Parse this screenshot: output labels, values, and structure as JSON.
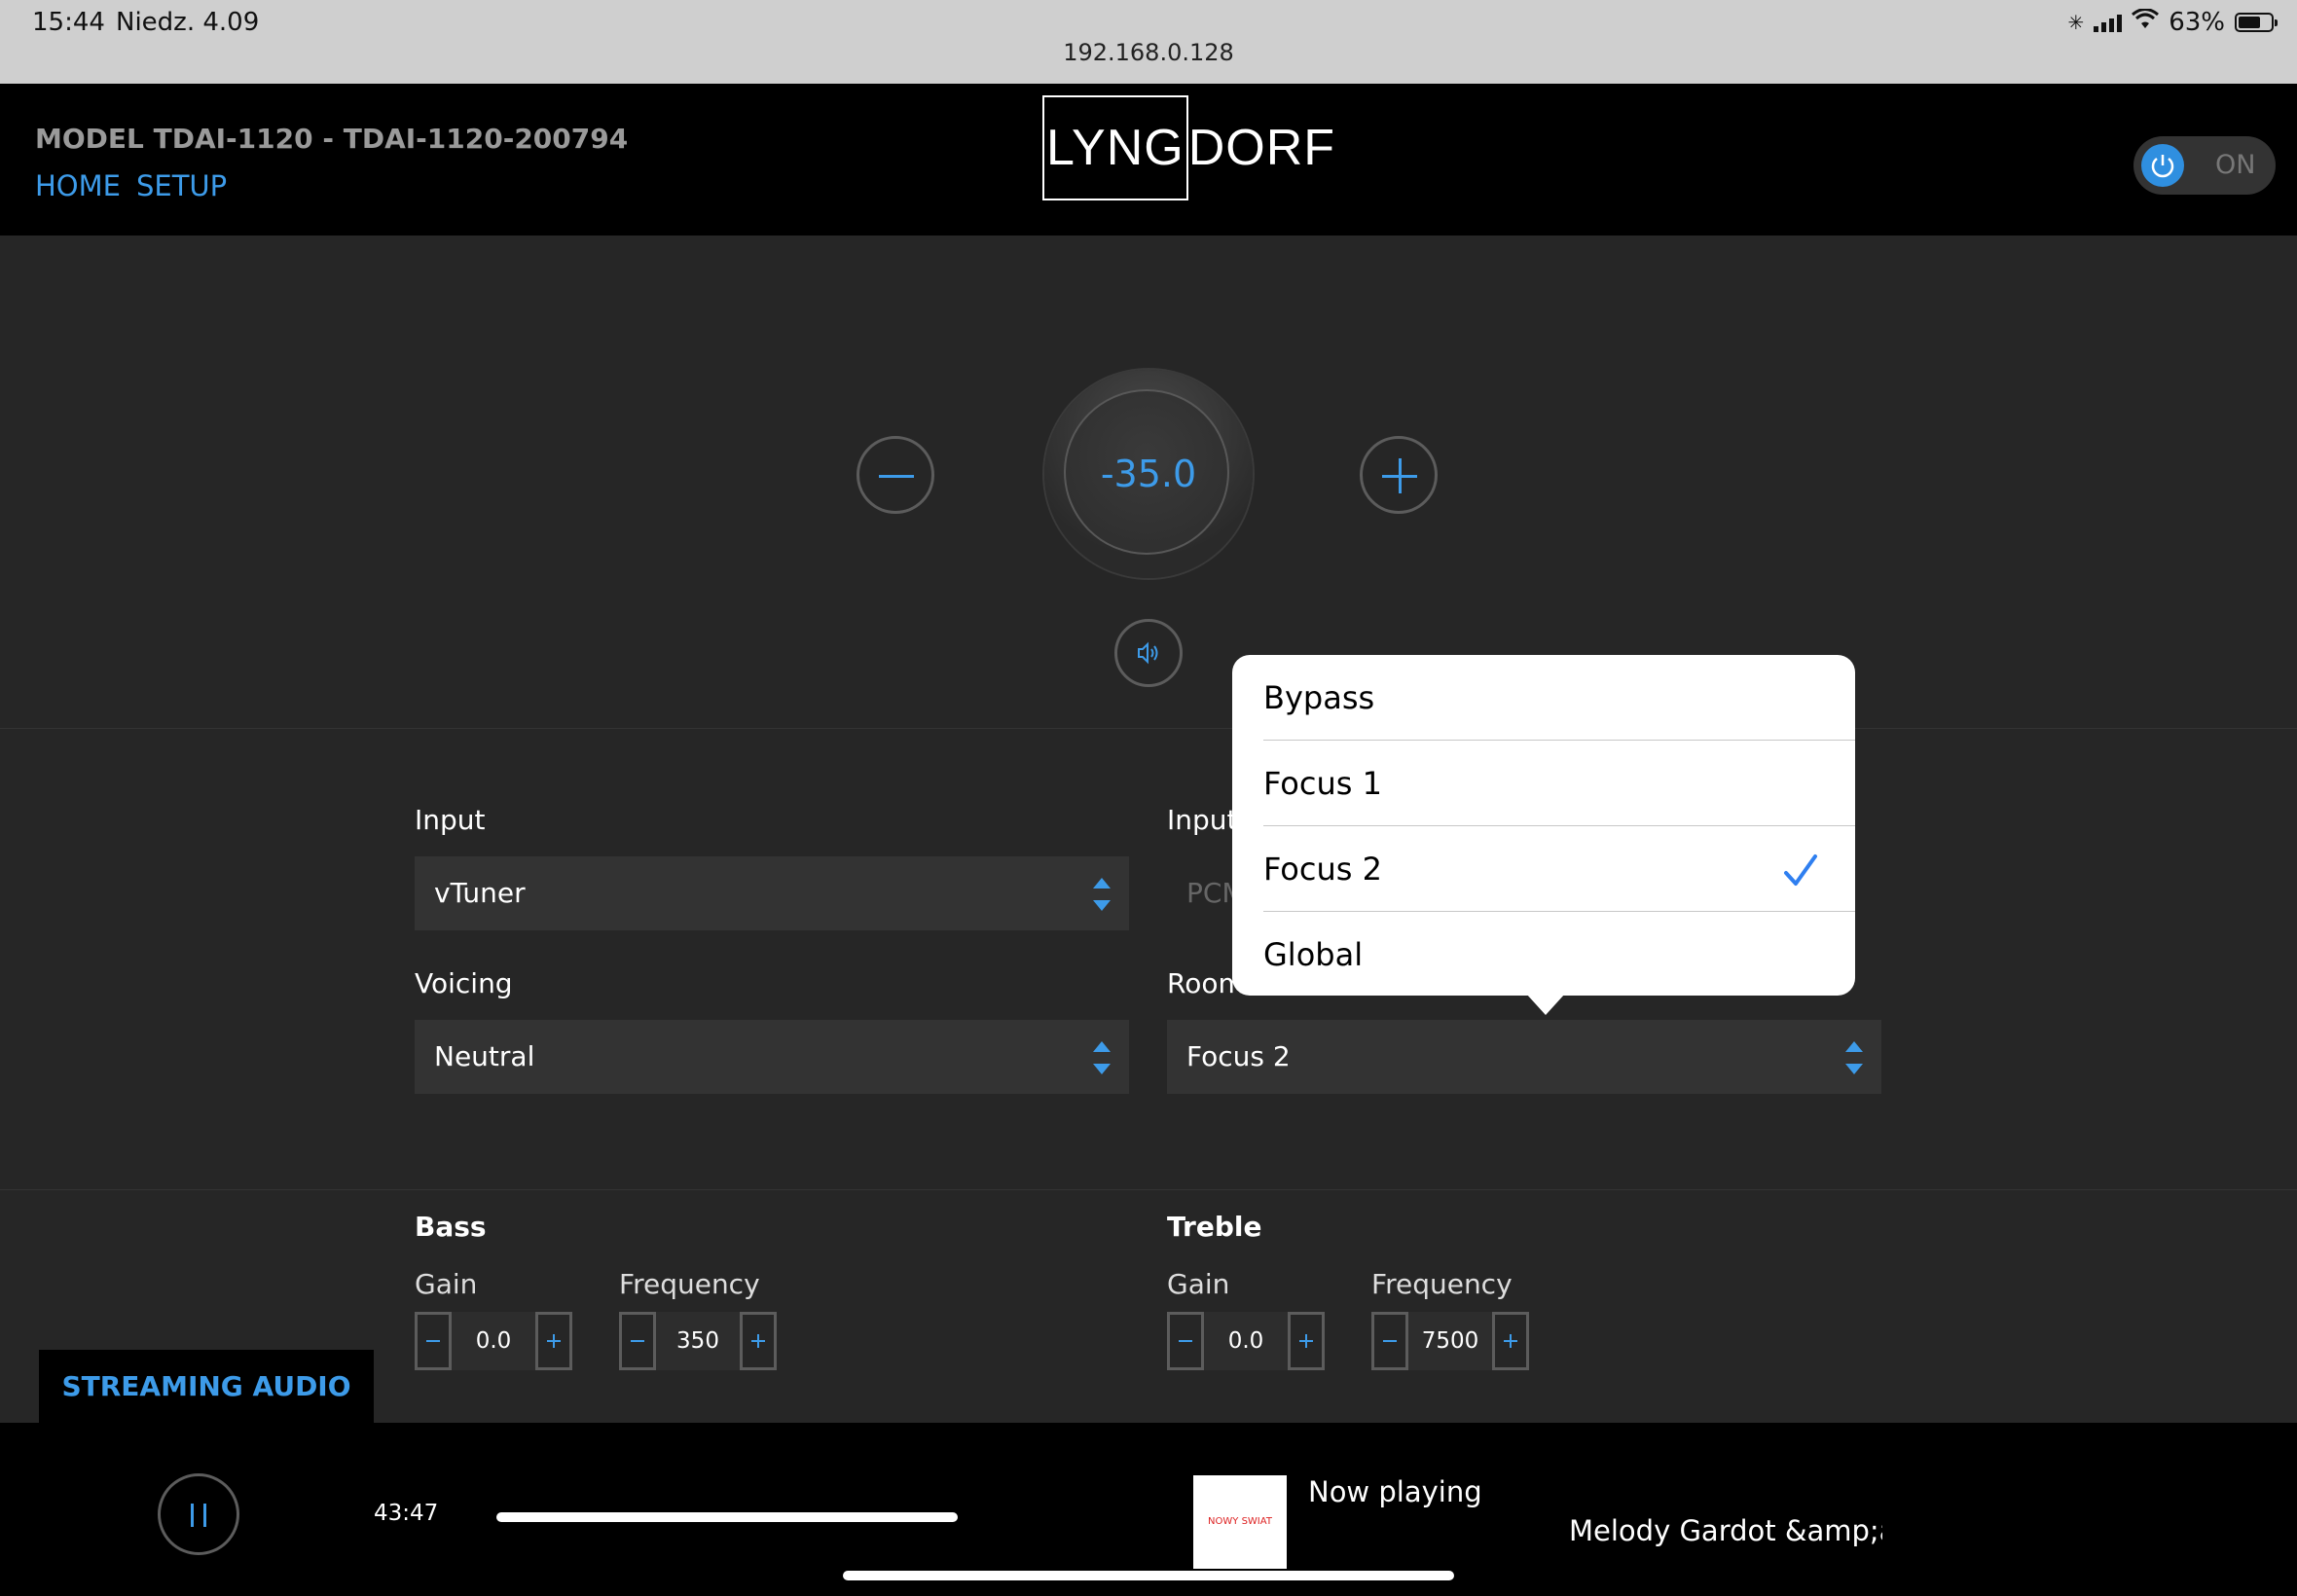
{
  "status_bar": {
    "time": "15:44",
    "date": "Niedz. 4.09",
    "url": "192.168.0.128",
    "battery": "63%",
    "battery_level": 0.63
  },
  "header": {
    "model": "MODEL TDAI-1120 - TDAI-1120-200794",
    "nav": {
      "home": "HOME",
      "setup": "SETUP"
    },
    "logo": {
      "left": "LYNG",
      "right": "DORF"
    },
    "power_label": "ON"
  },
  "volume": {
    "value": "-35.0"
  },
  "controls": {
    "input": {
      "label": "Input",
      "value": "vTuner"
    },
    "input_format": {
      "label": "Input",
      "value": "PCM"
    },
    "voicing": {
      "label": "Voicing",
      "value": "Neutral"
    },
    "room": {
      "label": "Room",
      "value": "Focus 2"
    }
  },
  "tone": {
    "bass": {
      "label": "Bass",
      "gain_label": "Gain",
      "gain": "0.0",
      "freq_label": "Frequency",
      "freq": "350"
    },
    "treble": {
      "label": "Treble",
      "gain_label": "Gain",
      "gain": "0.0",
      "freq_label": "Frequency",
      "freq": "7500"
    }
  },
  "player": {
    "tab": "STREAMING AUDIO",
    "elapsed": "43:47",
    "now_playing": "Now playing",
    "track": "Melody Gardot &amp;am",
    "art_text": "NOWY SWIAT"
  },
  "popover": {
    "options": [
      "Bypass",
      "Focus 1",
      "Focus 2",
      "Global"
    ],
    "selected": "Focus 2"
  },
  "colors": {
    "accent": "#3d9be9",
    "background": "#262626",
    "header": "#000000"
  }
}
